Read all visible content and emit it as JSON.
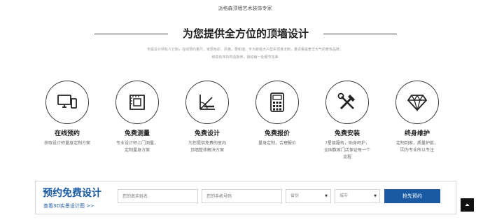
{
  "header": {
    "eyebrow": "派格森顶墙艺术装饰专家",
    "title": "为您提供全方位的顶墙设计",
    "intro_lines": [
      "专属设计师私人订制，在线预约量尺，家居色彩、风格，要和谐。专为新婚大户型吊顶身定制，量译量富奢华大气的奢侈品牌，",
      "缔造有序的构造脉序，接动每一处细节完美"
    ]
  },
  "services": [
    {
      "icon": "computer-icon",
      "title": "在线预约",
      "desc": [
        "获取设计师量身定制方案"
      ]
    },
    {
      "icon": "ruler-icon",
      "title": "免费测量",
      "desc": [
        "专业设计师上门测量，",
        "定制量身方案"
      ]
    },
    {
      "icon": "drafting-icon",
      "title": "免费设计",
      "desc": [
        "为您提供免费的室内",
        "顶墙整体解决方案"
      ]
    },
    {
      "icon": "calculator-icon",
      "title": "免费报价",
      "desc": [
        "量身定制，合理报价"
      ]
    },
    {
      "icon": "tools-icon",
      "title": "免费安装",
      "desc": [
        "7星级服务，贴身呵护，",
        "全国数家门店保证每一个",
        "流程"
      ]
    },
    {
      "icon": "diamond-icon",
      "title": "终身维护",
      "desc": [
        "定制到家，质量护航，",
        "因为专业所以专注"
      ]
    }
  ],
  "form": {
    "title": "预约免费设计",
    "link": "查看3D实景设计图 >>",
    "name_placeholder": "您的真实姓名",
    "phone_placeholder": "您的手机号码",
    "province": "省份",
    "city": "城市",
    "submit": "抢先预约"
  },
  "colors": {
    "accent": "#1a5aa3",
    "icon_stroke": "#222222"
  }
}
